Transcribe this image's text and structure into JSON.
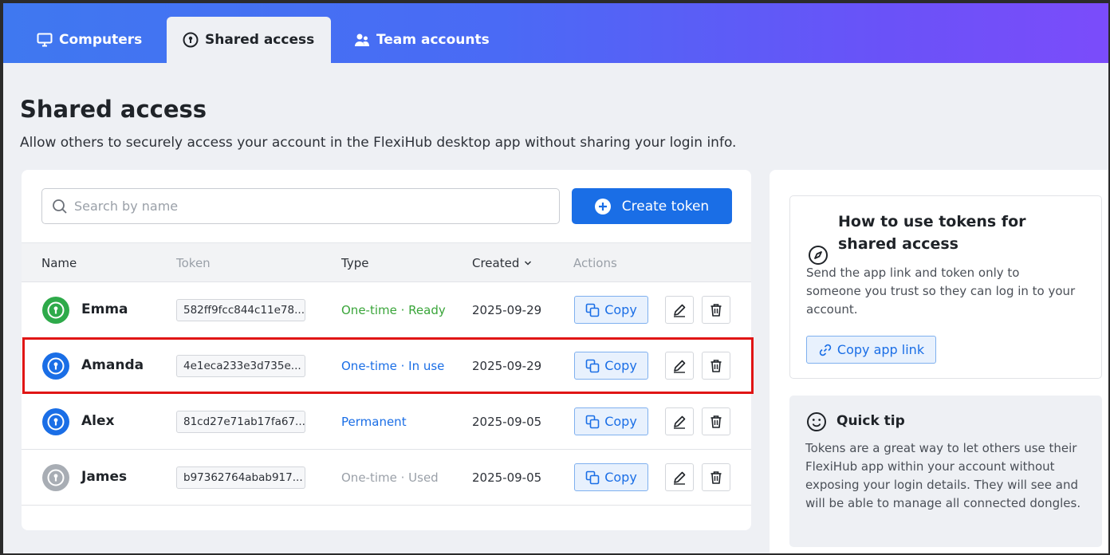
{
  "tabs": [
    {
      "label": "Computers",
      "icon": "monitor-icon",
      "active": false
    },
    {
      "label": "Shared access",
      "icon": "key-circle-icon",
      "active": true
    },
    {
      "label": "Team accounts",
      "icon": "users-icon",
      "active": false
    }
  ],
  "page": {
    "title": "Shared access",
    "subtitle": "Allow others to securely access your account in the FlexiHub desktop app without sharing your login info."
  },
  "search": {
    "placeholder": "Search by name",
    "value": ""
  },
  "create_button": {
    "label": "Create token"
  },
  "table": {
    "headers": {
      "name": "Name",
      "token": "Token",
      "type": "Type",
      "created": "Created",
      "actions": "Actions"
    },
    "sort_indicator": "chevron-down-icon",
    "rows": [
      {
        "name": "Emma",
        "token": "582ff9fcc844c11e78...",
        "type": "One-time · Ready",
        "type_color": "#3aa53a",
        "created": "2025-09-29",
        "avatar_color": "#2eaa4a",
        "copy_label": "Copy"
      },
      {
        "name": "Amanda",
        "token": "4e1eca233e3d735e...",
        "type": "One-time · In use",
        "type_color": "#1a6ee6",
        "created": "2025-09-29",
        "avatar_color": "#1a6ee6",
        "copy_label": "Copy"
      },
      {
        "name": "Alex",
        "token": "81cd27e71ab17fa67...",
        "type": "Permanent",
        "type_color": "#1a6ee6",
        "created": "2025-09-05",
        "avatar_color": "#1a6ee6",
        "copy_label": "Copy"
      },
      {
        "name": "James",
        "token": "b97362764abab917...",
        "type": "One-time · Used",
        "type_color": "#9aa0a8",
        "created": "2025-09-05",
        "avatar_color": "#a8adb4",
        "copy_label": "Copy"
      }
    ]
  },
  "howto": {
    "title": "How to use tokens for shared access",
    "body": "Send the app link and token only to someone you trust so they can log in to your account.",
    "link_label": "Copy app link"
  },
  "tip": {
    "title": "Quick tip",
    "body": "Tokens are a great way to let others use their FlexiHub app within your account without exposing your login details. They will see and will be able to manage all connected dongles."
  },
  "colors": {
    "accent": "#1a6ee6",
    "highlight": "#e01515"
  }
}
